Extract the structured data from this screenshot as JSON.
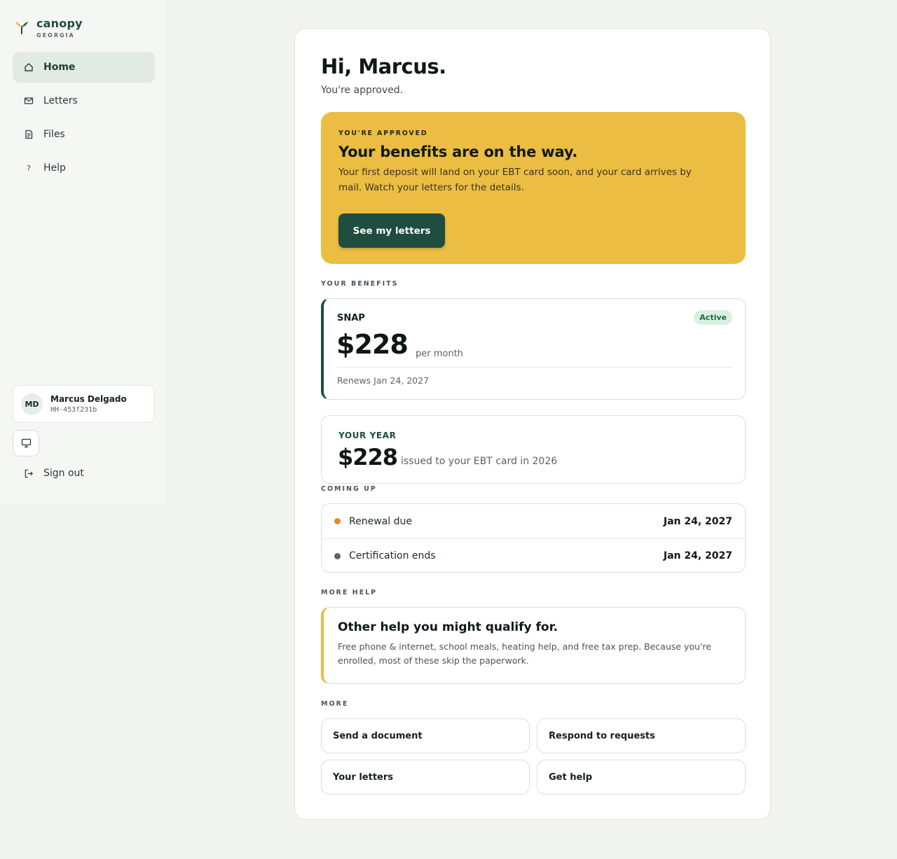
{
  "brand": {
    "name": "canopy",
    "region": "GEORGIA"
  },
  "nav": {
    "items": [
      {
        "label": "Home",
        "icon": "home-icon",
        "active": true
      },
      {
        "label": "Letters",
        "icon": "mail-icon"
      },
      {
        "label": "Files",
        "icon": "file-icon"
      },
      {
        "label": "Help",
        "icon": "question-icon"
      }
    ]
  },
  "user": {
    "initials": "MD",
    "name": "Marcus Delgado",
    "id": "HH-453f231b"
  },
  "signout_label": "Sign out",
  "greeting": {
    "title": "Hi, Marcus.",
    "subtitle": "You're approved."
  },
  "hero": {
    "eyebrow": "YOU'RE APPROVED",
    "title": "Your benefits are on the way.",
    "body": "Your first deposit will land on your EBT card soon, and your card arrives by mail. Watch your letters for the details.",
    "button": "See my letters",
    "color": "#ebbd42"
  },
  "sections": {
    "benefits": "YOUR BENEFITS",
    "coming_up": "COMING UP",
    "more_help": "MORE HELP",
    "more": "MORE"
  },
  "snap": {
    "name": "SNAP",
    "status": "Active",
    "amount": "$228",
    "period": "per month",
    "renews": "Renews Jan 24, 2027"
  },
  "year": {
    "label": "YOUR YEAR",
    "amount": "$228",
    "desc": "issued to your EBT card in 2026"
  },
  "upcoming": [
    {
      "label": "Renewal due",
      "date": "Jan 24, 2027",
      "color": "#e08a2c"
    },
    {
      "label": "Certification ends",
      "date": "Jan 24, 2027",
      "color": "#56675f"
    }
  ],
  "help": {
    "title": "Other help you might qualify for.",
    "body": "Free phone & internet, school meals, heating help, and free tax prep. Because you're enrolled, most of these skip the paperwork."
  },
  "more": [
    {
      "label": "Send a document"
    },
    {
      "label": "Respond to requests"
    },
    {
      "label": "Your letters"
    },
    {
      "label": "Get help"
    }
  ]
}
